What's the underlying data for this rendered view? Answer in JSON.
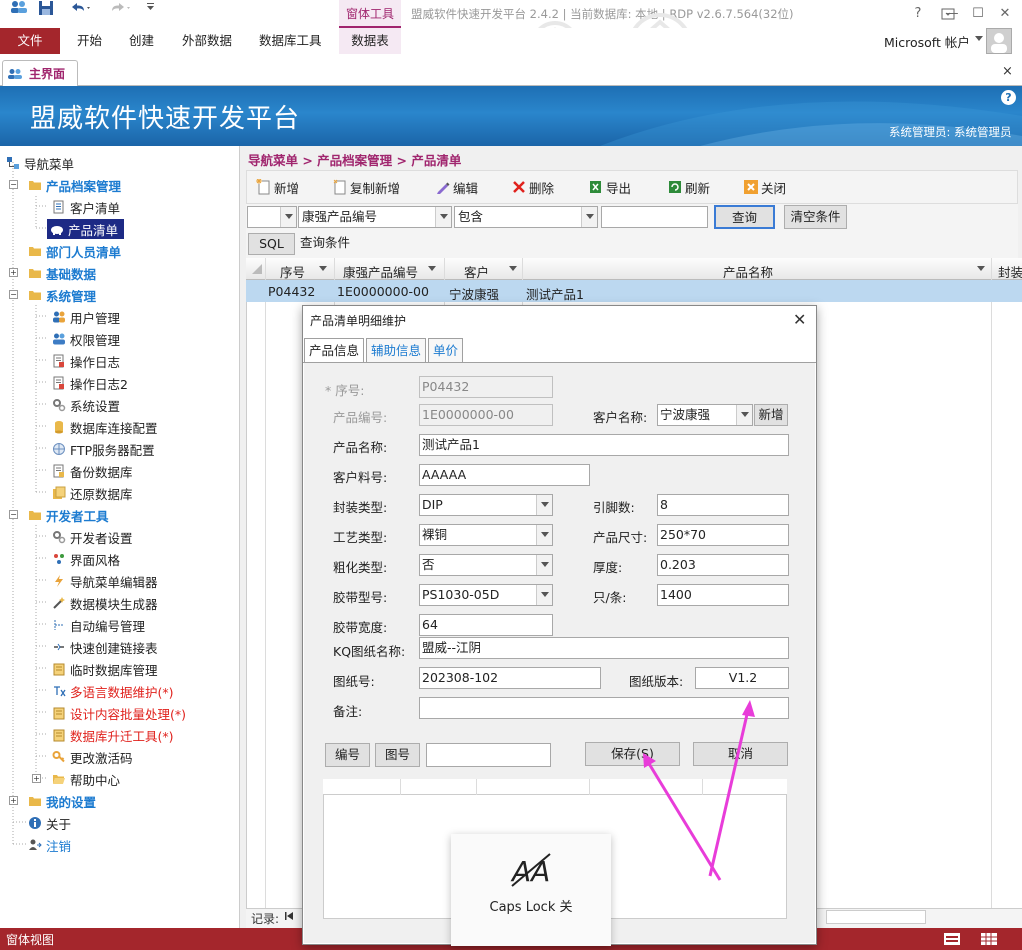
{
  "window": {
    "context_group": "窗体工具",
    "title": "盟威软件快速开发平台 2.4.2 | 当前数据库: 本地 | RDP v2.6.7.564(32位)",
    "help": "?",
    "minimize": "—",
    "maximize": "☐",
    "close": "✕"
  },
  "ribbon": {
    "file": "文件",
    "tabs": [
      "开始",
      "创建",
      "外部数据",
      "数据库工具",
      "数据表"
    ],
    "account": "Microsoft 帐户"
  },
  "doc": {
    "tab_label": "主界面",
    "close": "×"
  },
  "banner": {
    "title": "盟威软件快速开发平台",
    "user": "系统管理员: 系统管理员",
    "help": "?"
  },
  "nav": {
    "root": "导航菜单",
    "items": [
      "产品档案管理",
      "客户清单",
      "产品清单",
      "部门人员清单",
      "基础数据",
      "系统管理",
      "用户管理",
      "权限管理",
      "操作日志",
      "操作日志2",
      "系统设置",
      "数据库连接配置",
      "FTP服务器配置",
      "备份数据库",
      "还原数据库",
      "开发者工具",
      "开发者设置",
      "界面风格",
      "导航菜单编辑器",
      "数据模块生成器",
      "自动编号管理",
      "快速创建链接表",
      "临时数据库管理",
      "多语言数据维护(*)",
      "设计内容批量处理(*)",
      "数据库升迁工具(*)",
      "更改激活码",
      "帮助中心",
      "我的设置",
      "关于",
      "注销"
    ]
  },
  "breadcrumb": "导航菜单 > 产品档案管理 > 产品清单",
  "toolbar": {
    "add": "新增",
    "copy_add": "复制新增",
    "edit": "编辑",
    "delete": "删除",
    "export": "导出",
    "refresh": "刷新",
    "close": "关闭"
  },
  "filter": {
    "field": "康强产品编号",
    "operator": "包含",
    "value": "",
    "query": "查询",
    "clear": "清空条件",
    "sql": "SQL",
    "condition_label": "查询条件"
  },
  "grid": {
    "columns": [
      "序号",
      "康强产品编号",
      "客户",
      "产品名称",
      "封装"
    ],
    "rows": [
      {
        "seq": "P04432",
        "code": "1E0000000-00",
        "customer": "宁波康强",
        "name": "测试产品1"
      }
    ],
    "record_label": "记录:"
  },
  "status": {
    "left": "窗体视图"
  },
  "dialog": {
    "title": "产品清单明细维护",
    "tabs": [
      "产品信息",
      "辅助信息",
      "单价"
    ],
    "fields": {
      "seq_label": "* 序号:",
      "seq": "P04432",
      "code_label": "产品编号:",
      "code": "1E0000000-00",
      "customer_label": "客户名称:",
      "customer": "宁波康强",
      "new_btn": "新增",
      "name_label": "产品名称:",
      "name": "测试产品1",
      "partno_label": "客户料号:",
      "partno": "AAAAA",
      "package_label": "封装类型:",
      "package": "DIP",
      "pins_label": "引脚数:",
      "pins": "8",
      "process_label": "工艺类型:",
      "process": "裸铜",
      "size_label": "产品尺寸:",
      "size": "250*70",
      "rough_label": "粗化类型:",
      "rough": "否",
      "thickness_label": "厚度:",
      "thickness": "0.203",
      "tape_label": "胶带型号:",
      "tape": "PS1030-05D",
      "per_strip_label": "只/条:",
      "per_strip": "1400",
      "tape_width_label": "胶带宽度:",
      "tape_width": "64",
      "kq_label": "KQ图纸名称:",
      "kq": "盟威--江阴",
      "drawing_label": "图纸号:",
      "drawing": "202308-102",
      "version_label": "图纸版本:",
      "version": "V1.2",
      "remark_label": "备注:",
      "remark": ""
    },
    "buttons": {
      "number": "编号",
      "drawing": "图号",
      "search": "",
      "save": "保存(S)",
      "cancel": "取消"
    }
  },
  "capslock": {
    "label": "Caps Lock 关"
  },
  "colors": {
    "accent_red": "#a4262c",
    "banner_blue": "#1e6fb4",
    "nav_blue": "#1c7bd0",
    "annotation_magenta": "#e83cd9"
  }
}
